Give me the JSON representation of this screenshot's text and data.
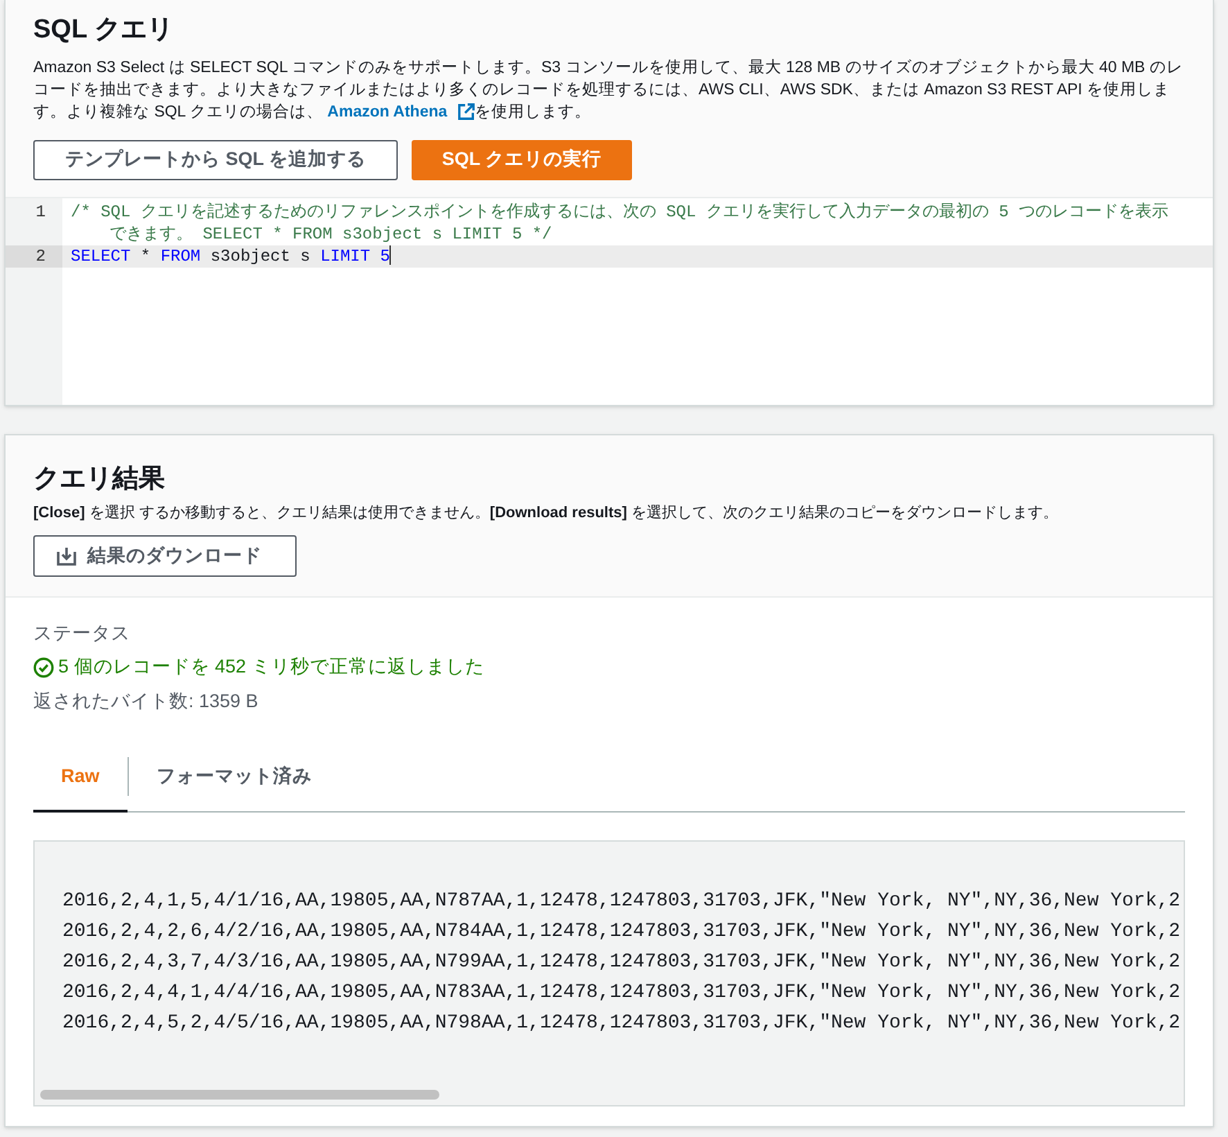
{
  "query_panel": {
    "title": "SQL クエリ",
    "description_before": "Amazon S3 Select は SELECT SQL コマンドのみをサポートします。S3 コンソールを使用して、最大 128 MB のサイズのオブジェクトから最大 40 MB のレコードを抽出できます。より大きなファイルまたはより多くのレコードを処理するには、AWS CLI、AWS SDK、または Amazon S3 REST API を使用します。より複雑な SQL クエリの場合は、",
    "description_link": "Amazon Athena",
    "description_after": "を使用します。",
    "buttons": [
      {
        "label": "テンプレートから SQL を追加する",
        "kind": "normal"
      },
      {
        "label": "SQL クエリの実行",
        "kind": "primary"
      }
    ],
    "editor_lines": [
      {
        "number": "1",
        "kind": "comment",
        "selected": false,
        "tokens": [
          {
            "text": "/* SQL クエリを記述するためのリファレンスポイントを作成するには、次の SQL クエリを実行して入力データの最初の 5 つのレコードを表示できます。 SELECT * FROM s3object s LIMIT 5 */",
            "kind": "comment"
          }
        ]
      },
      {
        "number": "2",
        "kind": "code",
        "selected": true,
        "tokens": [
          {
            "text": "SELECT",
            "kind": "keyword"
          },
          {
            "text": " * ",
            "kind": "plain"
          },
          {
            "text": "FROM",
            "kind": "keyword"
          },
          {
            "text": " s3object s ",
            "kind": "plain"
          },
          {
            "text": "LIMIT",
            "kind": "keyword"
          },
          {
            "text": " 5",
            "kind": "keyword"
          }
        ]
      }
    ]
  },
  "results_panel": {
    "title": "クエリ結果",
    "description": "**[Close]** を選択 するか移動すると、クエリ結果は使用できません。**[Download results]** を選択して、次のクエリ結果のコピーをダウンロードします。",
    "download_button": "結果のダウンロード",
    "status_label": "ステータス",
    "status_message": "5 個のレコードを 452 ミリ秒で正常に返しました",
    "bytes_returned": "返されたバイト数: 1359 B",
    "tabs": [
      {
        "label": "Raw",
        "selected": true
      },
      {
        "label": "フォーマット済み",
        "selected": false
      }
    ],
    "raw_lines": [
      "2016,2,4,1,5,4/1/16,AA,19805,AA,N787AA,1,12478,1247803,31703,JFK,\"New York, NY\",NY,36,New York,2",
      "2016,2,4,2,6,4/2/16,AA,19805,AA,N784AA,1,12478,1247803,31703,JFK,\"New York, NY\",NY,36,New York,2",
      "2016,2,4,3,7,4/3/16,AA,19805,AA,N799AA,1,12478,1247803,31703,JFK,\"New York, NY\",NY,36,New York,2",
      "2016,2,4,4,1,4/4/16,AA,19805,AA,N783AA,1,12478,1247803,31703,JFK,\"New York, NY\",NY,36,New York,2",
      "2016,2,4,5,2,4/5/16,AA,19805,AA,N798AA,1,12478,1247803,31703,JFK,\"New York, NY\",NY,36,New York,2"
    ]
  }
}
